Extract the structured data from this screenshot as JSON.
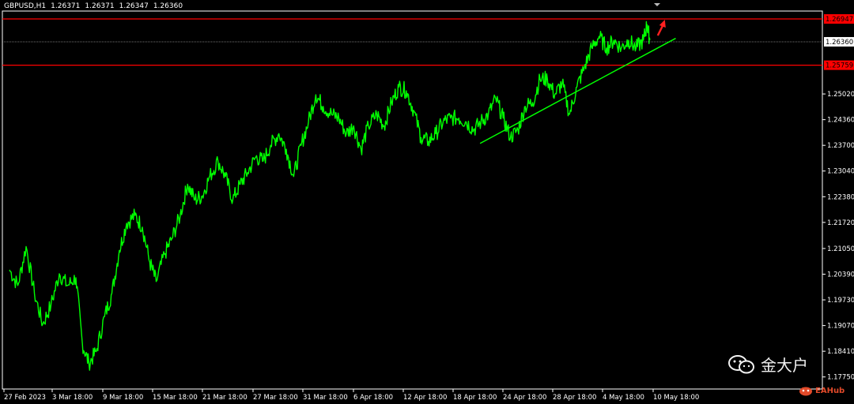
{
  "header": {
    "symbol": "GBPUSD,H1",
    "open": "1.26371",
    "high": "1.26371",
    "low": "1.26347",
    "close": "1.26360"
  },
  "watermark": {
    "text": "金大户",
    "icon": "wechat-icon"
  },
  "brand": {
    "text": "EAHub",
    "icon": "eahub-logo-icon"
  },
  "colors": {
    "background": "#000000",
    "price_line": "#00ff00",
    "trendline": "#00ff00",
    "level_line": "#ff0000",
    "arrow": "#ff2020",
    "axis_text": "#ffffff",
    "current_price_line": "#9a9a9a"
  },
  "chart_data": {
    "type": "line",
    "title": "",
    "xlabel": "",
    "ylabel": "",
    "ylim": [
      1.1744,
      1.2715
    ],
    "grid": false,
    "x_ticks": [
      "27 Feb 2023",
      "3 Mar 18:00",
      "9 Mar 18:00",
      "15 Mar 18:00",
      "21 Mar 18:00",
      "27 Mar 18:00",
      "31 Mar 18:00",
      "6 Apr 18:00",
      "12 Apr 18:00",
      "18 Apr 18:00",
      "24 Apr 18:00",
      "28 Apr 18:00",
      "4 May 18:00",
      "10 May 18:00"
    ],
    "y_ticks": [
      1.1775,
      1.1841,
      1.1907,
      1.1973,
      1.2039,
      1.2105,
      1.2172,
      1.2238,
      1.2304,
      1.237,
      1.2436,
      1.2502
    ],
    "y_tick_labels": [
      "1.17750",
      "1.18410",
      "1.19070",
      "1.19730",
      "1.20390",
      "1.21050",
      "1.21720",
      "1.22380",
      "1.23040",
      "1.23700",
      "1.24360",
      "1.25020"
    ],
    "x_range": [
      0,
      53
    ],
    "series": [
      {
        "values": [
          [
            0.0,
            1.205
          ],
          [
            0.9,
            1.201
          ],
          [
            1.8,
            1.211
          ],
          [
            2.7,
            1.199
          ],
          [
            3.6,
            1.191
          ],
          [
            4.5,
            1.196
          ],
          [
            5.4,
            1.204
          ],
          [
            6.3,
            1.201
          ],
          [
            7.2,
            1.203
          ],
          [
            7.9,
            1.186
          ],
          [
            8.6,
            1.181
          ],
          [
            9.4,
            1.184
          ],
          [
            10.3,
            1.193
          ],
          [
            11.1,
            1.199
          ],
          [
            11.9,
            1.21
          ],
          [
            12.7,
            1.217
          ],
          [
            13.6,
            1.219
          ],
          [
            14.4,
            1.216
          ],
          [
            15.2,
            1.207
          ],
          [
            15.9,
            1.202
          ],
          [
            16.8,
            1.209
          ],
          [
            17.6,
            1.213
          ],
          [
            18.5,
            1.219
          ],
          [
            19.3,
            1.227
          ],
          [
            20.1,
            1.223
          ],
          [
            20.9,
            1.224
          ],
          [
            21.7,
            1.229
          ],
          [
            22.6,
            1.233
          ],
          [
            23.4,
            1.229
          ],
          [
            24.2,
            1.223
          ],
          [
            25.0,
            1.227
          ],
          [
            25.8,
            1.23
          ],
          [
            26.7,
            1.234
          ],
          [
            27.5,
            1.233
          ],
          [
            28.3,
            1.237
          ],
          [
            29.2,
            1.24
          ],
          [
            30.0,
            1.236
          ],
          [
            30.8,
            1.229
          ],
          [
            31.6,
            1.237
          ],
          [
            32.4,
            1.243
          ],
          [
            33.2,
            1.25
          ],
          [
            34.0,
            1.247
          ],
          [
            34.9,
            1.245
          ],
          [
            35.7,
            1.244
          ],
          [
            36.5,
            1.24
          ],
          [
            37.3,
            1.242
          ],
          [
            38.1,
            1.236
          ],
          [
            38.9,
            1.242
          ],
          [
            39.8,
            1.245
          ],
          [
            40.6,
            1.242
          ],
          [
            41.4,
            1.248
          ],
          [
            42.2,
            1.252
          ],
          [
            43.0,
            1.251
          ],
          [
            43.8,
            1.246
          ],
          [
            44.6,
            1.239
          ],
          [
            45.4,
            1.238
          ],
          [
            46.2,
            1.24
          ],
          [
            47.0,
            1.243
          ],
          [
            47.8,
            1.244
          ],
          [
            48.7,
            1.244
          ],
          [
            49.5,
            1.243
          ],
          [
            50.3,
            1.241
          ],
          [
            51.1,
            1.243
          ],
          [
            51.9,
            1.245
          ],
          [
            52.7,
            1.249
          ],
          [
            53.5,
            1.244
          ],
          [
            54.3,
            1.239
          ],
          [
            55.1,
            1.241
          ],
          [
            55.9,
            1.247
          ],
          [
            56.7,
            1.248
          ],
          [
            57.5,
            1.254
          ],
          [
            58.3,
            1.254
          ],
          [
            59.1,
            1.25
          ],
          [
            59.9,
            1.253
          ],
          [
            60.7,
            1.245
          ],
          [
            61.5,
            1.252
          ],
          [
            62.3,
            1.257
          ],
          [
            63.1,
            1.262
          ],
          [
            63.9,
            1.265
          ],
          [
            64.7,
            1.262
          ],
          [
            65.5,
            1.264
          ],
          [
            66.3,
            1.262
          ],
          [
            67.1,
            1.264
          ],
          [
            67.9,
            1.262
          ],
          [
            68.7,
            1.264
          ],
          [
            69.1,
            1.268
          ],
          [
            69.4,
            1.264
          ]
        ]
      }
    ],
    "trendline": {
      "from": [
        51.0,
        1.2375
      ],
      "to": [
        72.2,
        1.2645
      ]
    },
    "levels": [
      1.26947,
      1.25759
    ],
    "level_labels": [
      "1.26947",
      "1.25759"
    ],
    "current_price": 1.2636,
    "current_price_label": "1.26360"
  }
}
